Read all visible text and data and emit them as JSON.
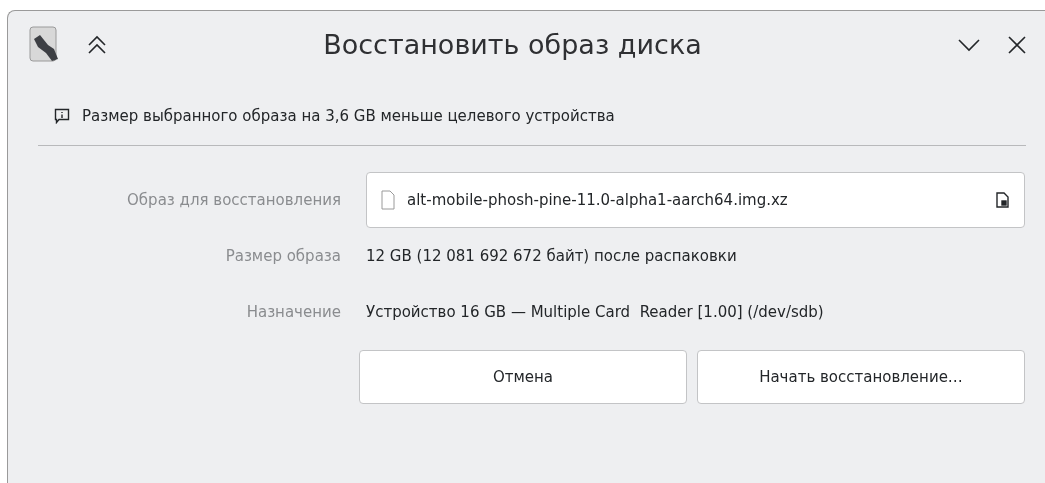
{
  "window": {
    "title": "Восстановить образ диска"
  },
  "message": {
    "text": "Размер выбранного образа на 3,6 GB меньше целевого устройства"
  },
  "image_field": {
    "label": "Образ для восстановления",
    "value": "alt-mobile-phosh-pine-11.0-alpha1-aarch64.img.xz"
  },
  "details": [
    {
      "label": "Размер образа",
      "value": "12 GB (12 081 692 672 байт) после распаковки"
    },
    {
      "label": "Назначение",
      "value": "Устройство 16 GB — Multiple Card  Reader [1.00] (/dev/sdb)"
    }
  ],
  "buttons": [
    "Отмена",
    "Начать восстановление…"
  ]
}
